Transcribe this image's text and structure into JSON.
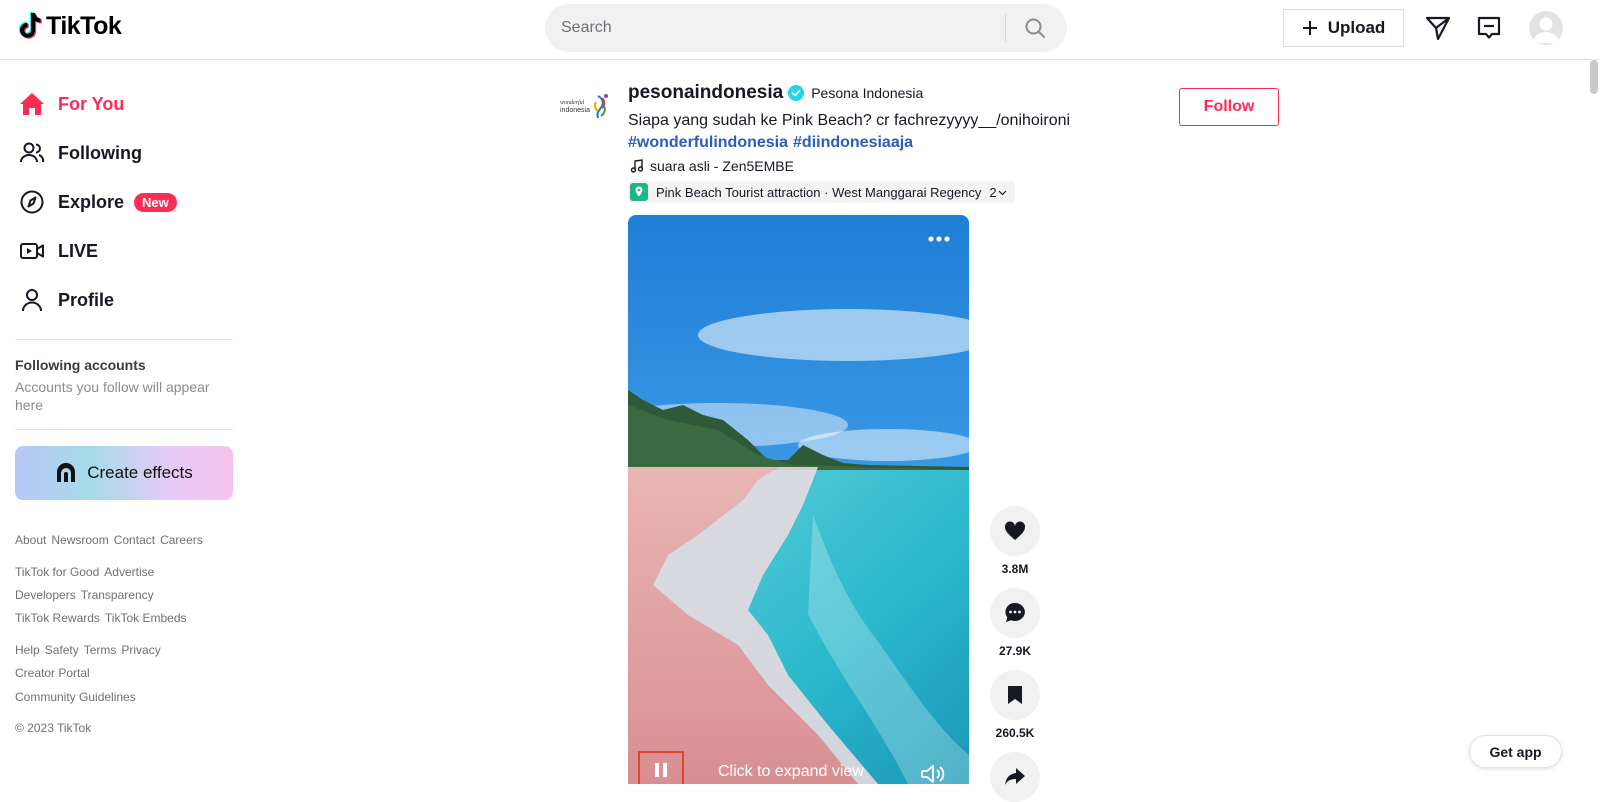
{
  "header": {
    "logo_text": "TikTok",
    "search_placeholder": "Search",
    "upload_label": "Upload"
  },
  "sidebar": {
    "nav": [
      {
        "label": "For You",
        "icon": "home-icon",
        "active": true
      },
      {
        "label": "Following",
        "icon": "users-icon"
      },
      {
        "label": "Explore",
        "icon": "compass-icon",
        "badge": "New"
      },
      {
        "label": "LIVE",
        "icon": "live-icon"
      },
      {
        "label": "Profile",
        "icon": "person-icon"
      }
    ],
    "following_title": "Following accounts",
    "following_sub": "Accounts you follow will appear here",
    "create_effects": "Create effects",
    "footer": [
      [
        "About",
        "Newsroom",
        "Contact",
        "Careers"
      ],
      [
        "TikTok for Good",
        "Advertise"
      ],
      [
        "Developers",
        "Transparency"
      ],
      [
        "TikTok Rewards",
        "TikTok Embeds"
      ],
      [
        "Help",
        "Safety",
        "Terms",
        "Privacy"
      ],
      [
        "Creator Portal"
      ],
      [
        "Community Guidelines"
      ]
    ],
    "copyright": "© 2023 TikTok"
  },
  "post": {
    "author_name": "pesonaindonesia",
    "author_nick": "Pesona Indonesia",
    "avatar_text_top": "wonderful",
    "avatar_text_bottom": "indonesia",
    "caption": "Siapa yang sudah ke Pink Beach? cr fachrezyyyy__/onihoironi",
    "hashtags": [
      "#wonderfulindonesia",
      "#diindonesiaaja"
    ],
    "music": "suara asli - Zen5EMBE",
    "location": "Pink Beach Tourist attraction · West Manggarai Regency",
    "location_count": "2",
    "follow_label": "Follow",
    "expand_text": "Click to expand view"
  },
  "actions": {
    "likes": "3.8M",
    "comments": "27.9K",
    "saves": "260.5K"
  },
  "get_app": "Get app",
  "colors": {
    "brand": "#fe2c55",
    "hashtag": "#2b5db9",
    "verified": "#20d5ec"
  }
}
